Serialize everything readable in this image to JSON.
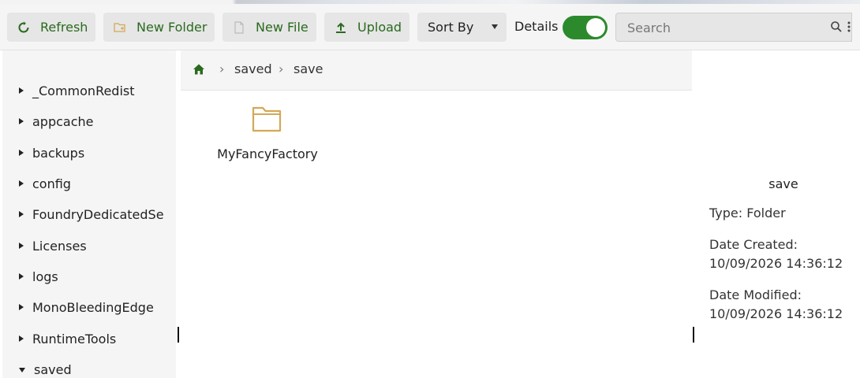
{
  "toolbar": {
    "refresh_label": "Refresh",
    "new_folder_label": "New Folder",
    "new_file_label": "New File",
    "upload_label": "Upload",
    "sort_by_label": "Sort By",
    "details_label": "Details",
    "details_enabled": true,
    "search_placeholder": "Search"
  },
  "tree": {
    "items": [
      {
        "label": "_CommonRedist",
        "expanded": false
      },
      {
        "label": "appcache",
        "expanded": false
      },
      {
        "label": "backups",
        "expanded": false
      },
      {
        "label": "config",
        "expanded": false
      },
      {
        "label": "FoundryDedicatedServer",
        "expanded": false
      },
      {
        "label": "Licenses",
        "expanded": false
      },
      {
        "label": "logs",
        "expanded": false
      },
      {
        "label": "MonoBleedingEdge",
        "expanded": false
      },
      {
        "label": "RuntimeTools",
        "expanded": false
      },
      {
        "label": "saved",
        "expanded": true
      }
    ]
  },
  "breadcrumb": {
    "items": [
      "saved",
      "save"
    ]
  },
  "files": [
    {
      "name": "MyFancyFactory",
      "type": "folder"
    }
  ],
  "details": {
    "name": "save",
    "type": "Type: Folder",
    "created_label": "Date Created:",
    "created_value": "10/09/2026 14:36:12",
    "modified_label": "Date Modified:",
    "modified_value": "10/09/2026 14:36:12"
  },
  "colors": {
    "accent_green": "#2a6a1e",
    "toggle_green": "#2c8a2c",
    "folder_tan": "#d4a857"
  }
}
